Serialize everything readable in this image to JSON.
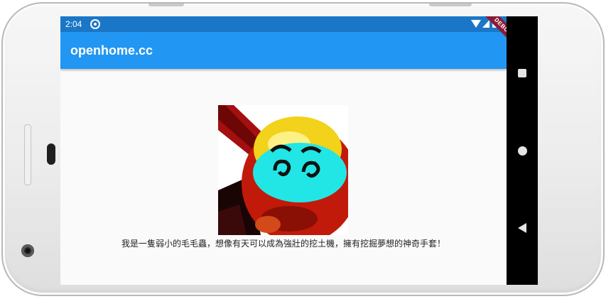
{
  "status_bar": {
    "time": "2:04"
  },
  "app_bar": {
    "title": "openhome.cc"
  },
  "debug_banner": {
    "label": "DEBUG"
  },
  "content": {
    "image_icon": "cartoon-ball-face",
    "caption": "我是一隻弱小的毛毛蟲，想像有天可以成為強壯的挖土機，擁有挖掘夢想的神奇手套！"
  },
  "navigation": {
    "recents_icon": "square-icon",
    "home_icon": "circle-icon",
    "back_icon": "triangle-back-icon"
  },
  "colors": {
    "status_bar": "#1a77c7",
    "app_bar": "#2196f3",
    "debug_banner": "#8b1a36",
    "background": "#fafafa"
  }
}
